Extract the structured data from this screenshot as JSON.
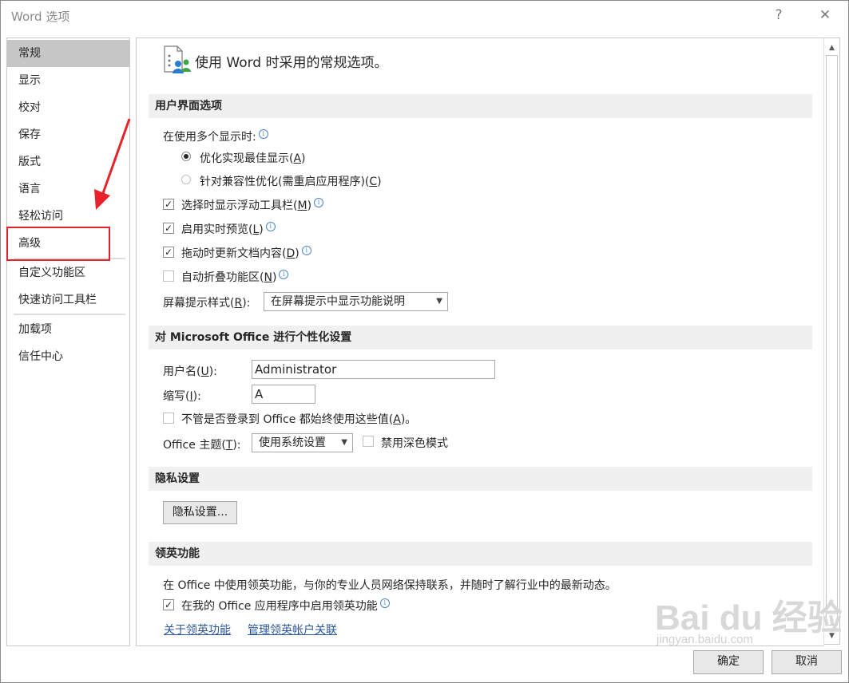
{
  "window": {
    "title": "Word 选项",
    "help": "?",
    "close": "✕"
  },
  "nav": {
    "items": [
      "常规",
      "显示",
      "校对",
      "保存",
      "版式",
      "语言",
      "轻松访问",
      "高级",
      "自定义功能区",
      "快速访问工具栏",
      "加载项",
      "信任中心"
    ],
    "selected_index": 0,
    "highlighted_index": 7
  },
  "header": {
    "text": "使用 Word 时采用的常规选项。",
    "icon": "general-options-icon"
  },
  "ui": {
    "section_title": "用户界面选项",
    "multi_display_label": "在使用多个显示时:",
    "radio_best": {
      "pre": "优化实现最佳显示(",
      "key": "A",
      "post": ")"
    },
    "radio_compat": {
      "pre": "针对兼容性优化(需重启应用程序)(",
      "key": "C",
      "post": ")"
    },
    "cb_mini_toolbar": {
      "pre": "选择时显示浮动工具栏(",
      "key": "M",
      "post": ")"
    },
    "cb_live_preview": {
      "pre": "启用实时预览(",
      "key": "L",
      "post": ")"
    },
    "cb_update_drag": {
      "pre": "拖动时更新文档内容(",
      "key": "D",
      "post": ")"
    },
    "cb_collapse_ribbon": {
      "pre": "自动折叠功能区(",
      "key": "N",
      "post": ")"
    },
    "screentip": {
      "pre": "屏幕提示样式(",
      "key": "R",
      "post": "):",
      "value": "在屏幕提示中显示功能说明"
    }
  },
  "personalize": {
    "section_title": "对 Microsoft Office 进行个性化设置",
    "username": {
      "pre": "用户名(",
      "key": "U",
      "post": "):",
      "value": "Administrator"
    },
    "initials": {
      "pre": "缩写(",
      "key": "I",
      "post": "):",
      "value": "A"
    },
    "always_use": {
      "pre": "不管是否登录到 Office 都始终使用这些值(",
      "key": "A",
      "post": ")。"
    },
    "theme": {
      "pre": "Office 主题(",
      "key": "T",
      "post": "):",
      "value": "使用系统设置"
    },
    "dark_mode": "禁用深色模式"
  },
  "privacy": {
    "section_title": "隐私设置",
    "button": "隐私设置..."
  },
  "linkedin": {
    "section_title": "领英功能",
    "description": "在 Office 中使用领英功能，与你的专业人员网络保持联系，并随时了解行业中的最新动态。",
    "enable": "在我的 Office 应用程序中启用领英功能",
    "link_about": "关于领英功能",
    "link_manage": "管理领英帐户关联"
  },
  "footer": {
    "ok": "确定",
    "cancel": "取消"
  },
  "watermark": {
    "main": "Bai du 经验",
    "sub": "jingyan.baidu.com"
  },
  "colors": {
    "highlight_box": "#e8212a",
    "arrow": "#e8212a",
    "link": "#2b579a",
    "selected_nav": "#c6c6c6",
    "section_bg": "#f0f0f0"
  }
}
